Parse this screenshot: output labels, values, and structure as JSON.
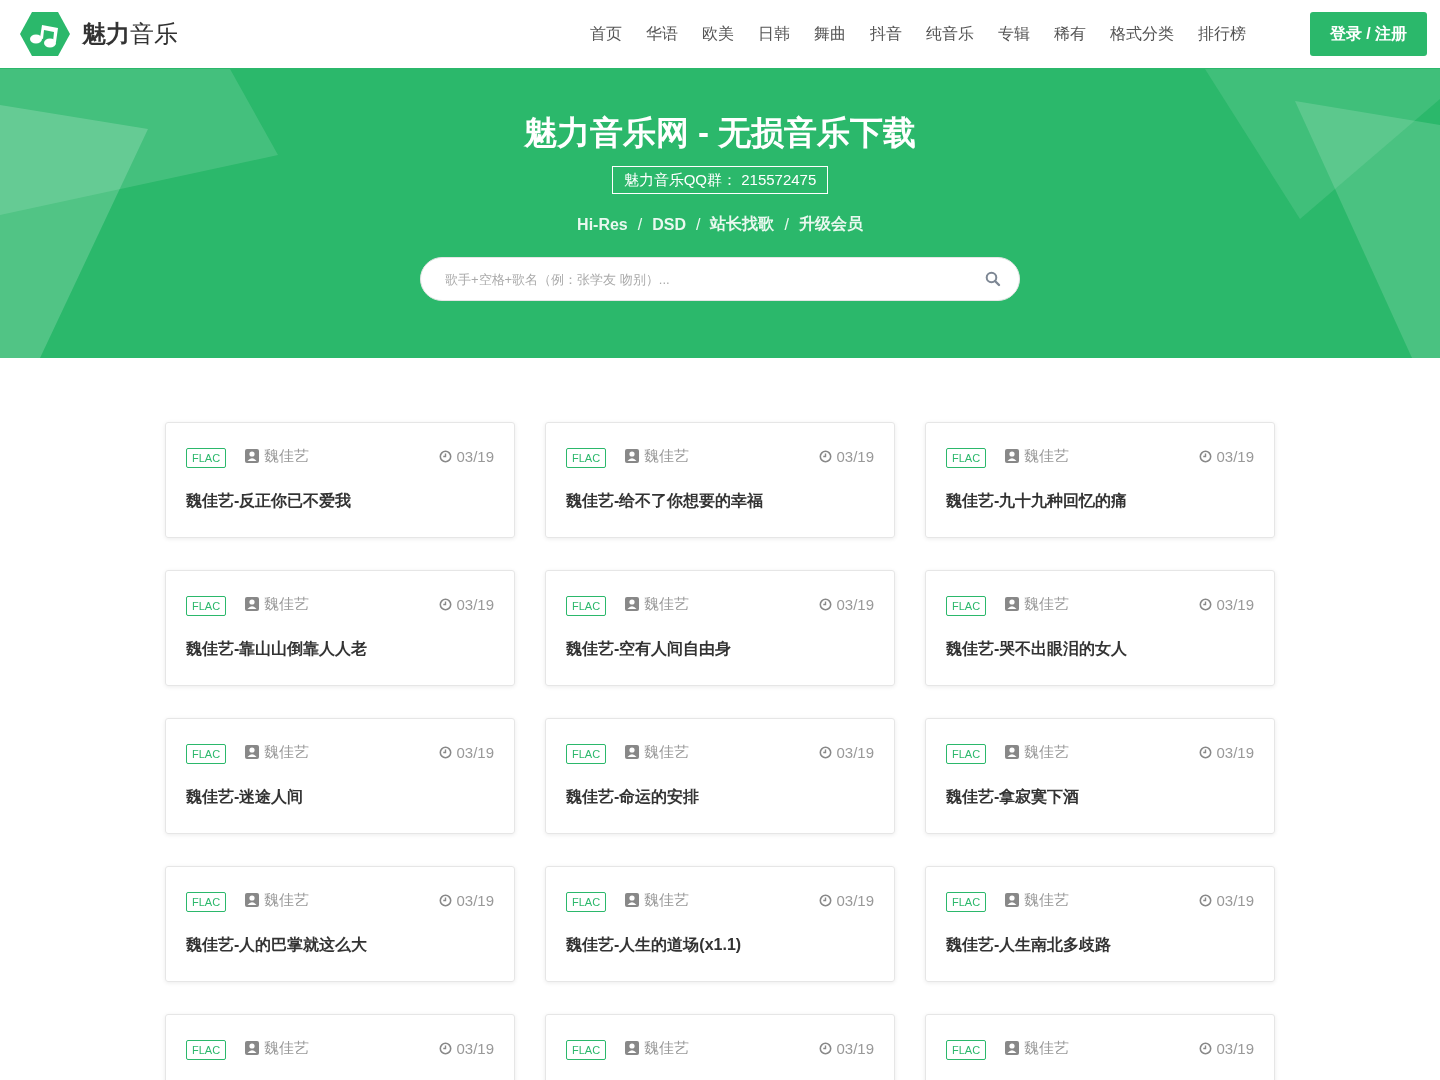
{
  "header": {
    "logo_text_bold": "魅力",
    "logo_text": "音乐",
    "nav": [
      {
        "label": "首页"
      },
      {
        "label": "华语"
      },
      {
        "label": "欧美"
      },
      {
        "label": "日韩"
      },
      {
        "label": "舞曲"
      },
      {
        "label": "抖音"
      },
      {
        "label": "纯音乐"
      },
      {
        "label": "专辑"
      },
      {
        "label": "稀有"
      },
      {
        "label": "格式分类"
      },
      {
        "label": "排行榜"
      }
    ],
    "login_button": "登录 / 注册"
  },
  "hero": {
    "title": "魅力音乐网 - 无损音乐下载",
    "qq_group": "魅力音乐QQ群： 215572475",
    "links": [
      {
        "label": "Hi-Res"
      },
      {
        "label": "DSD"
      },
      {
        "label": "站长找歌"
      },
      {
        "label": "升级会员"
      }
    ],
    "separator": "/",
    "search": {
      "placeholder": "歌手+空格+歌名（例：张学友 吻别）..."
    }
  },
  "songs": [
    {
      "format": "FLAC",
      "artist": "魏佳艺",
      "date": "03/19",
      "title": "魏佳艺-反正你已不爱我"
    },
    {
      "format": "FLAC",
      "artist": "魏佳艺",
      "date": "03/19",
      "title": "魏佳艺-给不了你想要的幸福"
    },
    {
      "format": "FLAC",
      "artist": "魏佳艺",
      "date": "03/19",
      "title": "魏佳艺-九十九种回忆的痛"
    },
    {
      "format": "FLAC",
      "artist": "魏佳艺",
      "date": "03/19",
      "title": "魏佳艺-靠山山倒靠人人老"
    },
    {
      "format": "FLAC",
      "artist": "魏佳艺",
      "date": "03/19",
      "title": "魏佳艺-空有人间自由身"
    },
    {
      "format": "FLAC",
      "artist": "魏佳艺",
      "date": "03/19",
      "title": "魏佳艺-哭不出眼泪的女人"
    },
    {
      "format": "FLAC",
      "artist": "魏佳艺",
      "date": "03/19",
      "title": "魏佳艺-迷途人间"
    },
    {
      "format": "FLAC",
      "artist": "魏佳艺",
      "date": "03/19",
      "title": "魏佳艺-命运的安排"
    },
    {
      "format": "FLAC",
      "artist": "魏佳艺",
      "date": "03/19",
      "title": "魏佳艺-拿寂寞下酒"
    },
    {
      "format": "FLAC",
      "artist": "魏佳艺",
      "date": "03/19",
      "title": "魏佳艺-人的巴掌就这么大"
    },
    {
      "format": "FLAC",
      "artist": "魏佳艺",
      "date": "03/19",
      "title": "魏佳艺-人生的道场(x1.1)"
    },
    {
      "format": "FLAC",
      "artist": "魏佳艺",
      "date": "03/19",
      "title": "魏佳艺-人生南北多歧路"
    },
    {
      "format": "FLAC",
      "artist": "魏佳艺",
      "date": "03/19"
    },
    {
      "format": "FLAC",
      "artist": "魏佳艺",
      "date": "03/19"
    },
    {
      "format": "FLAC",
      "artist": "魏佳艺",
      "date": "03/19"
    }
  ]
}
